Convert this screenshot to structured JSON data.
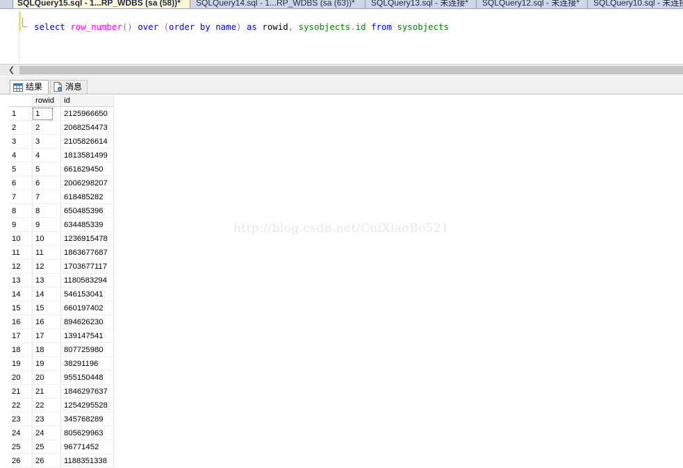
{
  "tabs": [
    {
      "label": "SQLQuery15.sql - 1...RP_WDBS (sa (58))*",
      "active": true
    },
    {
      "label": "SQLQuery14.sql - 1...RP_WDBS (sa (63))*",
      "active": false
    },
    {
      "label": "SQLQuery13.sql - 未连接*",
      "active": false
    },
    {
      "label": "SQLQuery12.sql - 未连接*",
      "active": false
    },
    {
      "label": "SQLQuery10.sql - 未连接",
      "active": false
    }
  ],
  "editor": {
    "tokens": [
      "select",
      " ",
      "row_number",
      "()",
      " ",
      "over",
      " ",
      "(",
      "order",
      " ",
      "by",
      " ",
      "name",
      ")",
      " ",
      "as",
      " ",
      "rowid",
      ",",
      " ",
      "sysobjects",
      ".",
      "id",
      " ",
      "from",
      " ",
      "sysobjects"
    ]
  },
  "results": {
    "tab_results": "结果",
    "tab_messages": "消息",
    "columns": [
      "rowid",
      "id"
    ],
    "rows": [
      [
        "1",
        "1",
        "2125966650"
      ],
      [
        "2",
        "2",
        "2068254473"
      ],
      [
        "3",
        "3",
        "2105826614"
      ],
      [
        "4",
        "4",
        "1813581499"
      ],
      [
        "5",
        "5",
        "661629450"
      ],
      [
        "6",
        "6",
        "2006298207"
      ],
      [
        "7",
        "7",
        "618485282"
      ],
      [
        "8",
        "8",
        "650485396"
      ],
      [
        "9",
        "9",
        "634485339"
      ],
      [
        "10",
        "10",
        "1236915478"
      ],
      [
        "11",
        "11",
        "1863677687"
      ],
      [
        "12",
        "12",
        "1703677117"
      ],
      [
        "13",
        "13",
        "1180583294"
      ],
      [
        "14",
        "14",
        "546153041"
      ],
      [
        "15",
        "15",
        "660197402"
      ],
      [
        "16",
        "16",
        "894626230"
      ],
      [
        "17",
        "17",
        "139147541"
      ],
      [
        "18",
        "18",
        "807725980"
      ],
      [
        "19",
        "19",
        "38291196"
      ],
      [
        "20",
        "20",
        "955150448"
      ],
      [
        "21",
        "21",
        "1846297637"
      ],
      [
        "22",
        "22",
        "1254295528"
      ],
      [
        "23",
        "23",
        "345768289"
      ],
      [
        "24",
        "24",
        "805629963"
      ],
      [
        "25",
        "25",
        "96771452"
      ],
      [
        "26",
        "26",
        "1188351338"
      ]
    ]
  },
  "watermark": "http://blog.csdn.net/CuiXiaoBo521"
}
